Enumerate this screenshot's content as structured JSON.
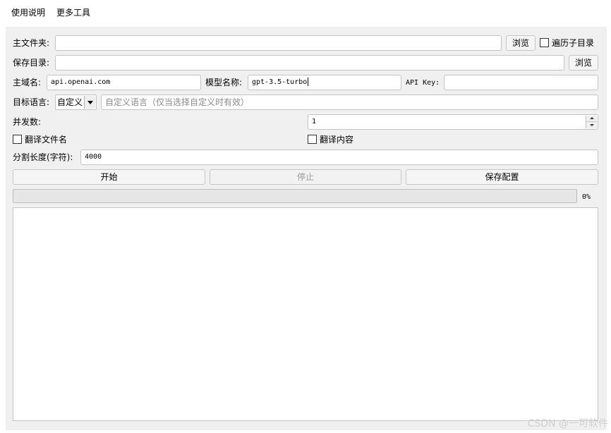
{
  "menu": {
    "items": [
      "使用说明",
      "更多工具"
    ]
  },
  "main_folder": {
    "label": "主文件夹:",
    "value": "",
    "browse_label": "浏览",
    "traverse_label": "遍历子目录",
    "traverse_checked": false
  },
  "save_dir": {
    "label": "保存目录:",
    "value": "",
    "browse_label": "浏览"
  },
  "domain": {
    "label": "主域名:",
    "value": "api.openai.com"
  },
  "model": {
    "label": "模型名称:",
    "value": "gpt-3.5-turbo"
  },
  "api_key": {
    "label": "API Key:",
    "value": ""
  },
  "target_lang": {
    "label": "目标语言:",
    "selected": "自定义",
    "custom_placeholder": "自定义语言（仅当选择自定义时有效）"
  },
  "concurrency": {
    "label": "并发数:",
    "value": "1"
  },
  "options": {
    "translate_filename_label": "翻译文件名",
    "translate_filename_checked": false,
    "translate_content_label": "翻译内容",
    "translate_content_checked": false
  },
  "split_length": {
    "label": "分割长度(字符):",
    "value": "4000"
  },
  "actions": {
    "start_label": "开始",
    "stop_label": "停止",
    "save_config_label": "保存配置"
  },
  "progress": {
    "value": 0,
    "text": "0%"
  },
  "log": {
    "text": ""
  },
  "watermark": "CSDN @一可软件",
  "colors": {
    "panel_bg": "#f0f0f0",
    "input_border": "#c4c4c4",
    "progress_fill": "#06b025"
  }
}
